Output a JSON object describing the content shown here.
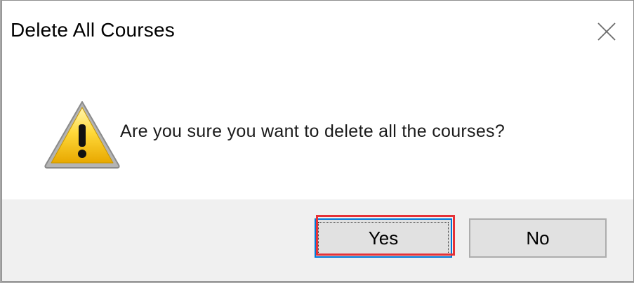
{
  "dialog": {
    "title": "Delete All Courses",
    "close_icon": "close-icon",
    "message": "Are you sure you want to delete all the courses?",
    "icon": "warning-icon",
    "buttons": {
      "yes_label": "Yes",
      "no_label": "No"
    }
  },
  "colors": {
    "highlight": "#e53238",
    "focus_border": "#0078d7",
    "footer_bg": "#f0f0f0"
  }
}
